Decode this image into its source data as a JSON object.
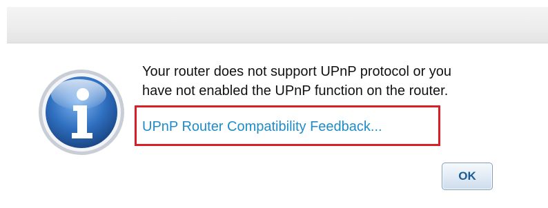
{
  "dialog": {
    "message_line1": "Your router does not support UPnP protocol or you",
    "message_line2": "have not enabled the UPnP function on the router.",
    "feedback_link": "UPnP Router Compatibility Feedback...",
    "ok_label": "OK",
    "icon": "info-icon"
  },
  "colors": {
    "link": "#1e8cc8",
    "highlight_border": "#d81f26",
    "icon_blue": "#2f6fc0",
    "ok_text": "#1a5d96"
  }
}
